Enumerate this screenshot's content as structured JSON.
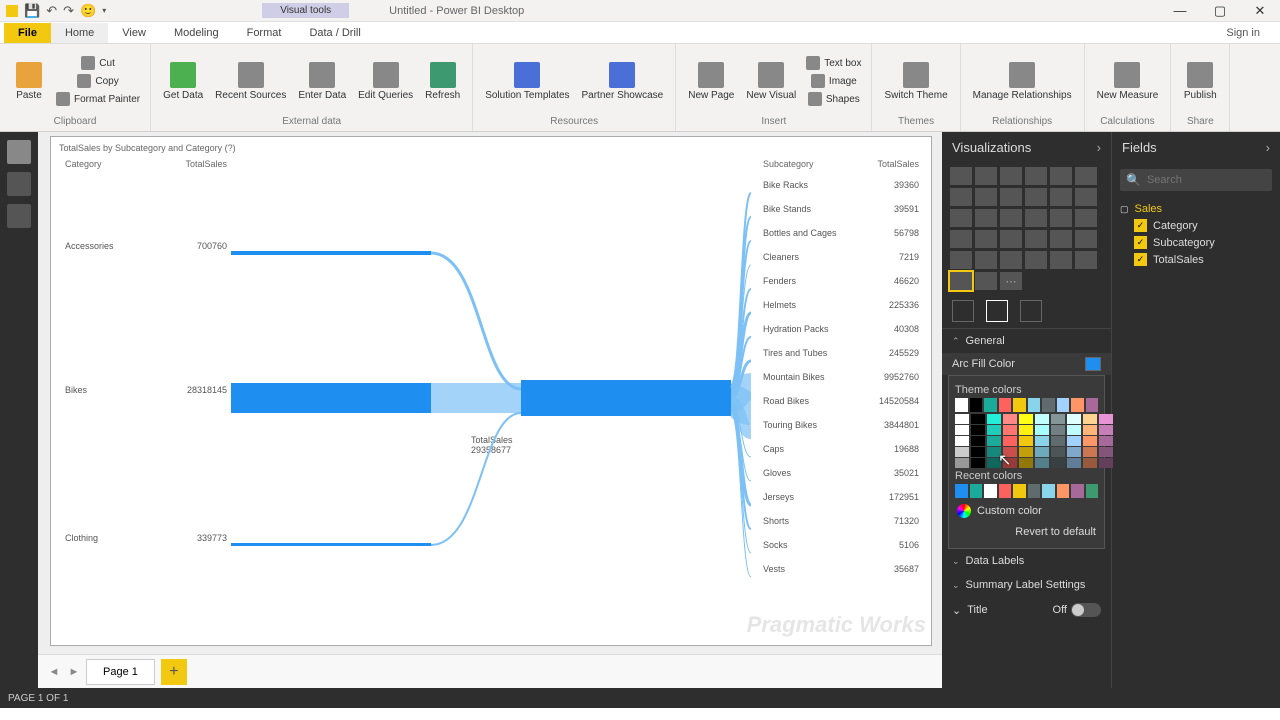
{
  "app": {
    "title": "Untitled - Power BI Desktop",
    "visual_tools": "Visual tools"
  },
  "window": {
    "signin": "Sign in"
  },
  "tabs": {
    "file": "File",
    "home": "Home",
    "view": "View",
    "modeling": "Modeling",
    "format": "Format",
    "datadrill": "Data / Drill"
  },
  "ribbon": {
    "paste": "Paste",
    "cut": "Cut",
    "copy": "Copy",
    "format_painter": "Format Painter",
    "getdata": "Get Data",
    "recent": "Recent Sources",
    "enter": "Enter Data",
    "edit": "Edit Queries",
    "refresh": "Refresh",
    "soltmpl": "Solution Templates",
    "partner": "Partner Showcase",
    "newpage": "New Page",
    "newvisual": "New Visual",
    "textbox": "Text box",
    "image": "Image",
    "shapes": "Shapes",
    "switchtheme": "Switch Theme",
    "managerel": "Manage Relationships",
    "newmeasure": "New Measure",
    "publish": "Publish",
    "grp_clipboard": "Clipboard",
    "grp_external": "External data",
    "grp_resources": "Resources",
    "grp_insert": "Insert",
    "grp_themes": "Themes",
    "grp_rel": "Relationships",
    "grp_calc": "Calculations",
    "grp_share": "Share"
  },
  "chart_data": {
    "type": "sankey",
    "title": "TotalSales by Subcategory and Category (?)",
    "left_header": {
      "cat": "Category",
      "val": "TotalSales"
    },
    "left": [
      {
        "name": "Accessories",
        "value": 700760
      },
      {
        "name": "Bikes",
        "value": 28318145
      },
      {
        "name": "Clothing",
        "value": 339773
      }
    ],
    "center": {
      "label": "TotalSales",
      "value": 29358677
    },
    "right_header": {
      "cat": "Subcategory",
      "val": "TotalSales"
    },
    "right": [
      {
        "name": "Bike Racks",
        "value": 39360
      },
      {
        "name": "Bike Stands",
        "value": 39591
      },
      {
        "name": "Bottles and Cages",
        "value": 56798
      },
      {
        "name": "Cleaners",
        "value": 7219
      },
      {
        "name": "Fenders",
        "value": 46620
      },
      {
        "name": "Helmets",
        "value": 225336
      },
      {
        "name": "Hydration Packs",
        "value": 40308
      },
      {
        "name": "Tires and Tubes",
        "value": 245529
      },
      {
        "name": "Mountain Bikes",
        "value": 9952760
      },
      {
        "name": "Road Bikes",
        "value": 14520584
      },
      {
        "name": "Touring Bikes",
        "value": 3844801
      },
      {
        "name": "Caps",
        "value": 19688
      },
      {
        "name": "Gloves",
        "value": 35021
      },
      {
        "name": "Jerseys",
        "value": 172951
      },
      {
        "name": "Shorts",
        "value": 71320
      },
      {
        "name": "Socks",
        "value": 5106
      },
      {
        "name": "Vests",
        "value": 35687
      }
    ]
  },
  "page": {
    "name": "Page 1",
    "status": "PAGE 1 OF 1"
  },
  "viz_pane": {
    "title": "Visualizations"
  },
  "format": {
    "general": "General",
    "arc_fill": "Arc Fill Color",
    "theme_colors": "Theme colors",
    "recent_colors": "Recent colors",
    "custom_color": "Custom color",
    "revert": "Revert to default",
    "data_labels": "Data Labels",
    "summary": "Summary Label Settings",
    "title": "Title",
    "title_state": "Off"
  },
  "fields_pane": {
    "title": "Fields",
    "search": "Search",
    "table": "Sales",
    "f1": "Category",
    "f2": "Subcategory",
    "f3": "TotalSales"
  },
  "colors": {
    "theme_top": [
      "#ffffff",
      "#000000",
      "#1aab9b",
      "#fd625e",
      "#f2c80f",
      "#8ad4eb",
      "#5f6b6d",
      "#a0d1ff",
      "#fe9666",
      "#a66999"
    ],
    "recent": [
      "#1f8ef1",
      "#1aab9b",
      "#ffffff",
      "#fd625e",
      "#f2c80f",
      "#5f6b6d",
      "#8ad4eb",
      "#fe9666",
      "#a66999",
      "#3d9970"
    ]
  },
  "watermark": "Pragmatic Works"
}
